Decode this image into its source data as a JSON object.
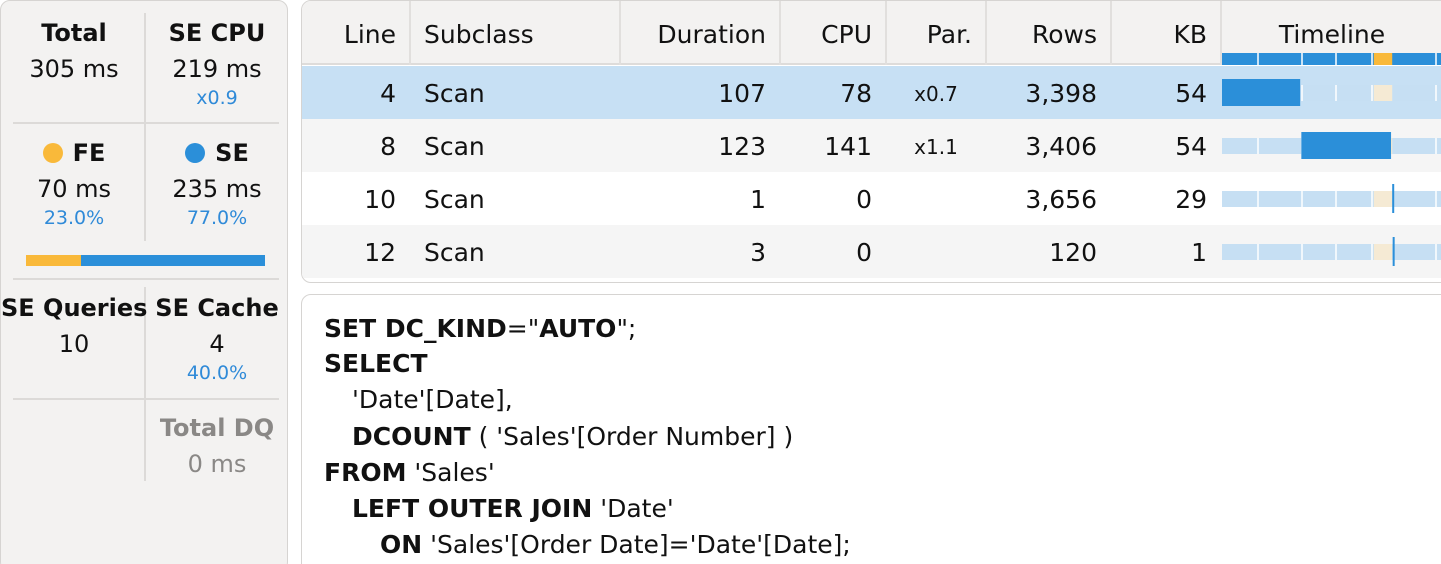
{
  "stats": {
    "total": {
      "label": "Total",
      "value": "305 ms"
    },
    "se_cpu": {
      "label": "SE CPU",
      "value": "219 ms",
      "sub": "x0.9"
    },
    "fe": {
      "label": "FE",
      "value": "70 ms",
      "sub": "23.0%",
      "color": "#f9b93a"
    },
    "se": {
      "label": "SE",
      "value": "235 ms",
      "sub": "77.0%",
      "color": "#2b8fd9"
    },
    "fe_fraction": 0.23,
    "se_queries": {
      "label": "SE Queries",
      "value": "10"
    },
    "se_cache": {
      "label": "SE Cache",
      "value": "4",
      "sub": "40.0%"
    },
    "total_dq": {
      "label": "Total DQ",
      "value": "0 ms"
    }
  },
  "table": {
    "columns": [
      "Line",
      "Subclass",
      "Duration",
      "CPU",
      "Par.",
      "Rows",
      "KB",
      "Timeline"
    ],
    "rows": [
      {
        "line": "4",
        "subclass": "Scan",
        "duration": "107",
        "cpu": "78",
        "par": "x0.7",
        "rows": "3,398",
        "kb": "54",
        "start": 0.0,
        "end": 0.34,
        "selected": true
      },
      {
        "line": "8",
        "subclass": "Scan",
        "duration": "123",
        "cpu": "141",
        "par": "x1.1",
        "rows": "3,406",
        "kb": "54",
        "start": 0.345,
        "end": 0.735,
        "selected": false
      },
      {
        "line": "10",
        "subclass": "Scan",
        "duration": "1",
        "cpu": "0",
        "par": "",
        "rows": "3,656",
        "kb": "29",
        "start": 0.74,
        "end": 0.745,
        "selected": false
      },
      {
        "line": "12",
        "subclass": "Scan",
        "duration": "3",
        "cpu": "0",
        "par": "",
        "rows": "120",
        "kb": "1",
        "start": 0.742,
        "end": 0.75,
        "selected": false
      }
    ],
    "timeline_fe_window": [
      0.66,
      0.74
    ]
  },
  "query": {
    "l1_kw": "SET DC_KIND",
    "l1_rest": "=\"",
    "l1_kw2": "AUTO",
    "l1_end": "\";",
    "l2_kw": "SELECT",
    "l3": "'Date'[Date],",
    "l4_kw": "DCOUNT",
    "l4_rest": " ( 'Sales'[Order Number] )",
    "l5_kw": "FROM",
    "l5_rest": " 'Sales'",
    "l6_kw": "LEFT OUTER JOIN",
    "l6_rest": " 'Date'",
    "l7_kw": "ON",
    "l7_rest": " 'Sales'[Order Date]='Date'[Date];"
  },
  "colors": {
    "selected_row": "#c7e0f4",
    "alt_row": "#f5f5f5",
    "bar": "#2b8fd9",
    "track": "#c6dff3",
    "fe_window": "#f5ead4"
  }
}
